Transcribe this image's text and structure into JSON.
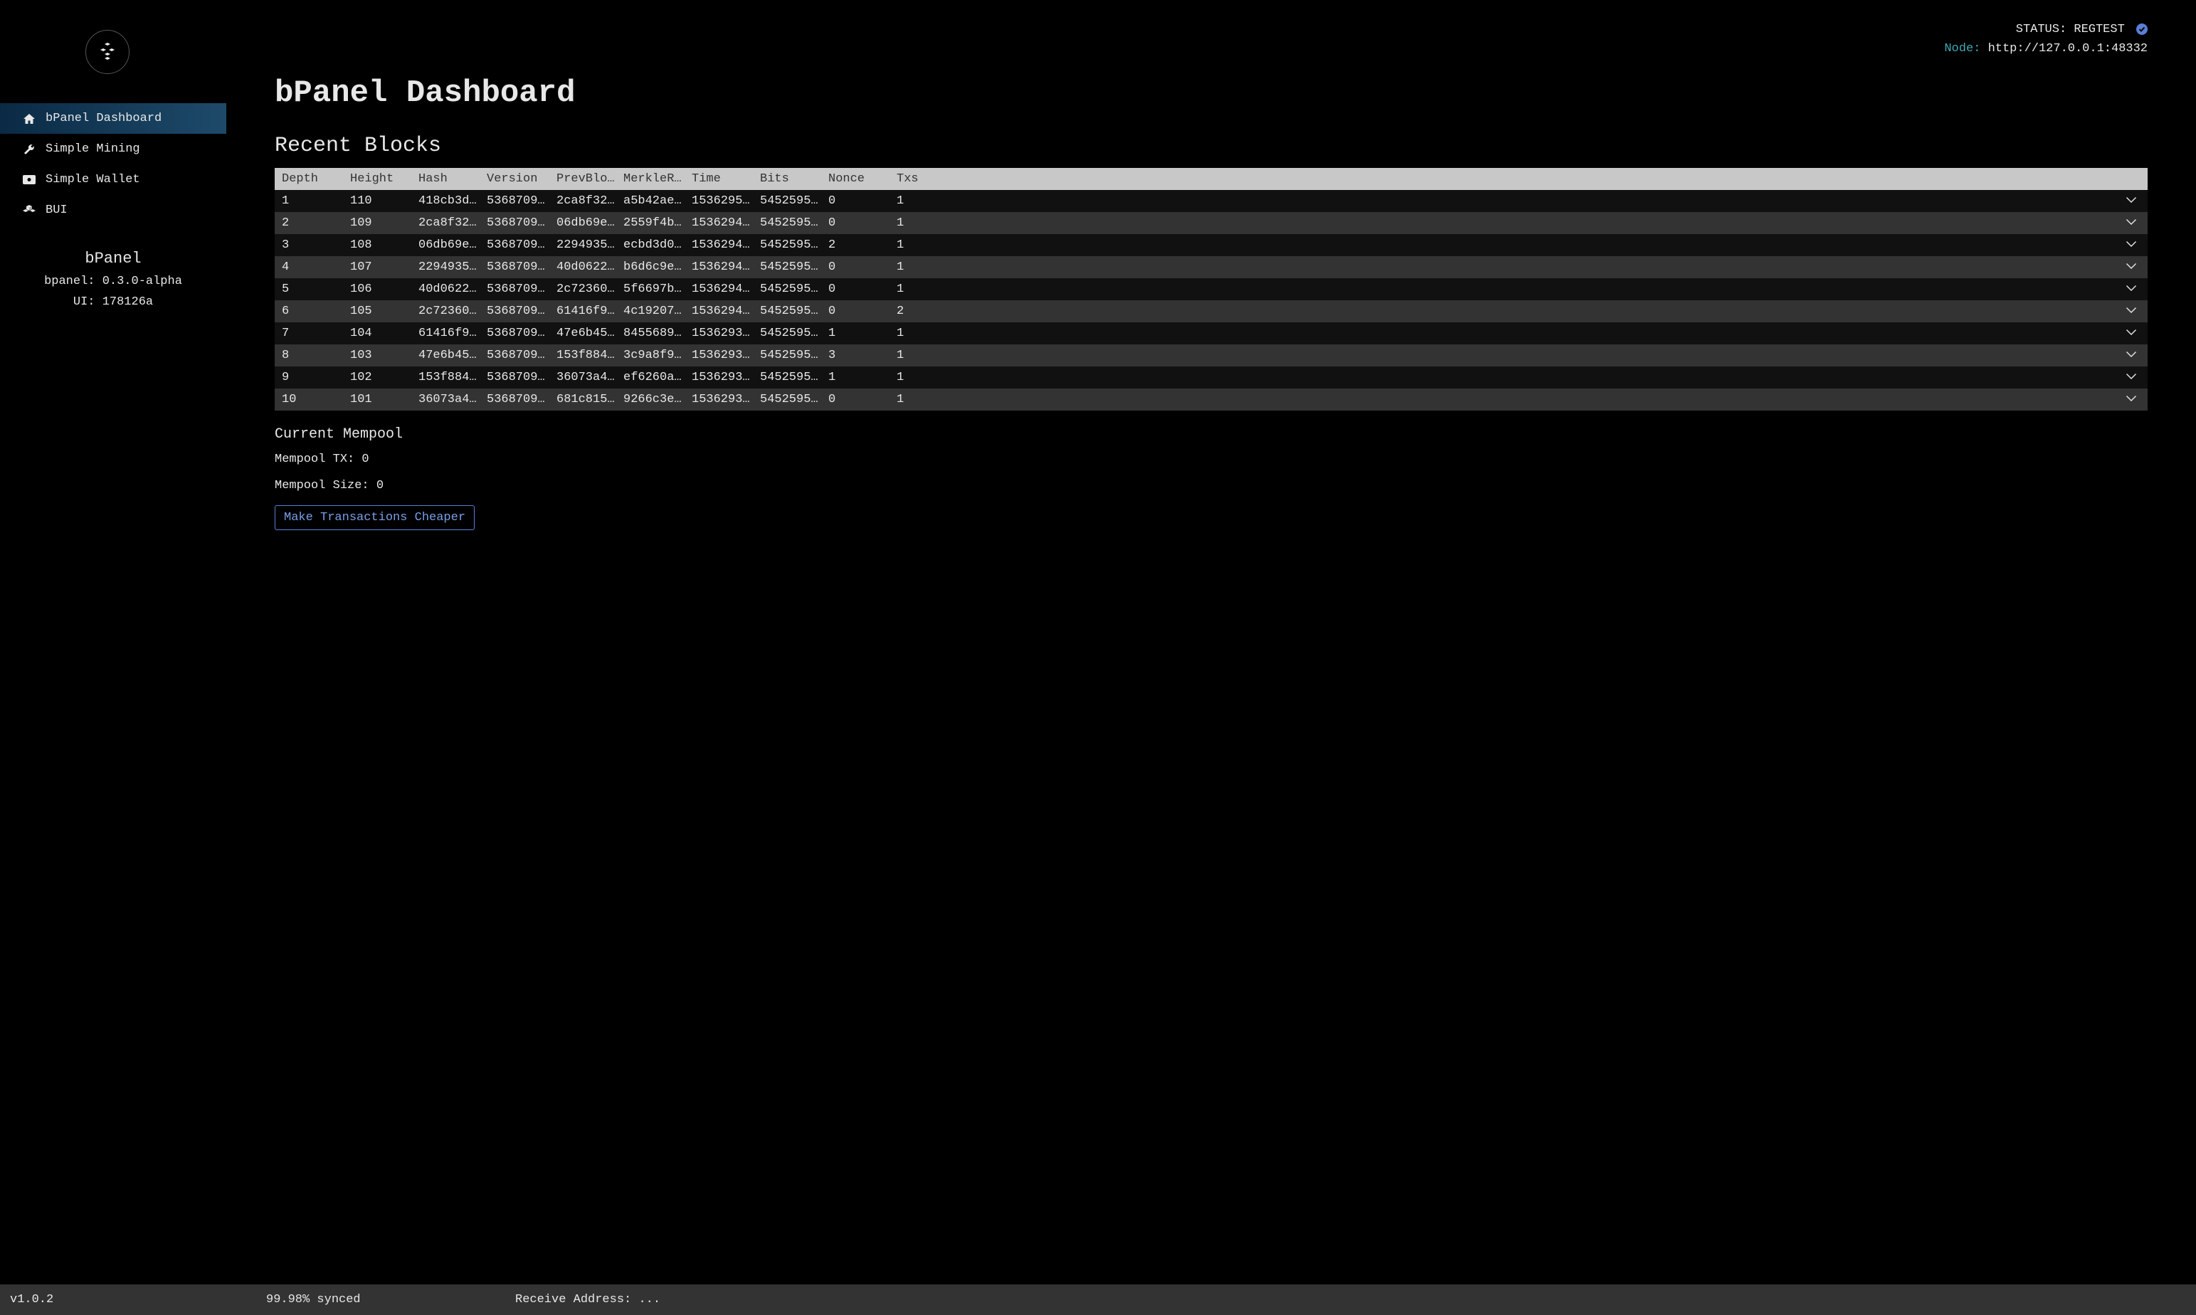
{
  "header": {
    "status_label": "STATUS:",
    "status_value": "REGTEST",
    "node_label": "Node:",
    "node_value": "http://127.0.0.1:48332"
  },
  "sidebar": {
    "items": [
      {
        "label": "bPanel Dashboard",
        "icon": "home-icon",
        "active": true
      },
      {
        "label": "Simple Mining",
        "icon": "wrench-icon",
        "active": false
      },
      {
        "label": "Simple Wallet",
        "icon": "wallet-icon",
        "active": false
      },
      {
        "label": "BUI",
        "icon": "cubes-icon",
        "active": false
      }
    ],
    "info": {
      "title": "bPanel",
      "version_line": "bpanel: 0.3.0-alpha",
      "ui_line": "UI: 178126a"
    }
  },
  "main": {
    "title": "bPanel Dashboard",
    "recent_blocks_title": "Recent Blocks",
    "columns": [
      "Depth",
      "Height",
      "Hash",
      "Version",
      "PrevBlock",
      "MerkleRoot",
      "Time",
      "Bits",
      "Nonce",
      "Txs"
    ],
    "rows": [
      {
        "depth": "1",
        "height": "110",
        "hash": "418cb3d…",
        "version": "5368709…",
        "prev": "2ca8f32…",
        "merkle": "a5b42ae…",
        "time": "1536295…",
        "bits": "5452595…",
        "nonce": "0",
        "txs": "1"
      },
      {
        "depth": "2",
        "height": "109",
        "hash": "2ca8f32…",
        "version": "5368709…",
        "prev": "06db69e…",
        "merkle": "2559f4b…",
        "time": "1536294…",
        "bits": "5452595…",
        "nonce": "0",
        "txs": "1"
      },
      {
        "depth": "3",
        "height": "108",
        "hash": "06db69e…",
        "version": "5368709…",
        "prev": "2294935…",
        "merkle": "ecbd3d0…",
        "time": "1536294…",
        "bits": "5452595…",
        "nonce": "2",
        "txs": "1"
      },
      {
        "depth": "4",
        "height": "107",
        "hash": "2294935…",
        "version": "5368709…",
        "prev": "40d0622…",
        "merkle": "b6d6c9e…",
        "time": "1536294…",
        "bits": "5452595…",
        "nonce": "0",
        "txs": "1"
      },
      {
        "depth": "5",
        "height": "106",
        "hash": "40d0622…",
        "version": "5368709…",
        "prev": "2c72360…",
        "merkle": "5f6697b…",
        "time": "1536294…",
        "bits": "5452595…",
        "nonce": "0",
        "txs": "1"
      },
      {
        "depth": "6",
        "height": "105",
        "hash": "2c72360…",
        "version": "5368709…",
        "prev": "61416f9…",
        "merkle": "4c19207…",
        "time": "1536294…",
        "bits": "5452595…",
        "nonce": "0",
        "txs": "2"
      },
      {
        "depth": "7",
        "height": "104",
        "hash": "61416f9…",
        "version": "5368709…",
        "prev": "47e6b45…",
        "merkle": "8455689…",
        "time": "1536293…",
        "bits": "5452595…",
        "nonce": "1",
        "txs": "1"
      },
      {
        "depth": "8",
        "height": "103",
        "hash": "47e6b45…",
        "version": "5368709…",
        "prev": "153f884…",
        "merkle": "3c9a8f9…",
        "time": "1536293…",
        "bits": "5452595…",
        "nonce": "3",
        "txs": "1"
      },
      {
        "depth": "9",
        "height": "102",
        "hash": "153f884…",
        "version": "5368709…",
        "prev": "36073a4…",
        "merkle": "ef6260a…",
        "time": "1536293…",
        "bits": "5452595…",
        "nonce": "1",
        "txs": "1"
      },
      {
        "depth": "10",
        "height": "101",
        "hash": "36073a4…",
        "version": "5368709…",
        "prev": "681c815…",
        "merkle": "9266c3e…",
        "time": "1536293…",
        "bits": "5452595…",
        "nonce": "0",
        "txs": "1"
      }
    ],
    "mempool_title": "Current Mempool",
    "mempool_tx_label": "Mempool TX: ",
    "mempool_tx_value": "0",
    "mempool_size_label": "Mempool Size: ",
    "mempool_size_value": "0",
    "button_label": "Make Transactions Cheaper"
  },
  "footer": {
    "version": "v1.0.2",
    "sync": "99.98% synced",
    "address_label": "Receive Address: ",
    "address_value": "..."
  }
}
